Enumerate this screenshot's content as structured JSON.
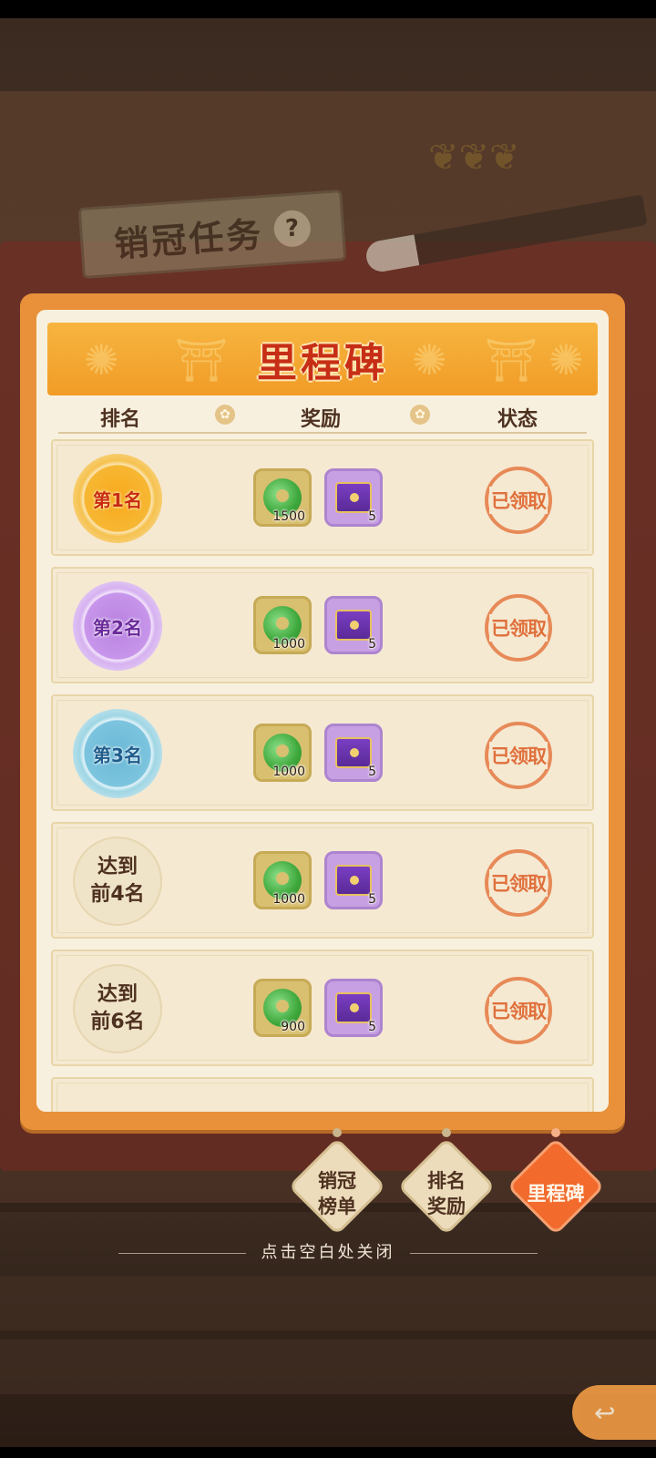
{
  "background": {
    "title_tag": "销冠任务",
    "help_icon": "?"
  },
  "panel": {
    "title": "里程碑",
    "headers": {
      "rank": "排名",
      "reward": "奖励",
      "status": "状态"
    },
    "rows": [
      {
        "rank": "第1名",
        "medal": "gold",
        "jade_count": "1500",
        "chest_count": "5",
        "status": "已领取"
      },
      {
        "rank": "第2名",
        "medal": "purple",
        "jade_count": "1000",
        "chest_count": "5",
        "status": "已领取"
      },
      {
        "rank": "第3名",
        "medal": "blue",
        "jade_count": "1000",
        "chest_count": "5",
        "status": "已领取"
      },
      {
        "rank_line1": "达到",
        "rank_line2": "前4名",
        "medal": "plain",
        "jade_count": "1000",
        "chest_count": "5",
        "status": "已领取"
      },
      {
        "rank_line1": "达到",
        "rank_line2": "前6名",
        "medal": "plain",
        "jade_count": "900",
        "chest_count": "5",
        "status": "已领取"
      }
    ]
  },
  "tabs": [
    {
      "line1": "销冠",
      "line2": "榜单",
      "active": false
    },
    {
      "line1": "排名",
      "line2": "奖励",
      "active": false
    },
    {
      "line1": "里程碑",
      "active": true
    }
  ],
  "close_hint": "点击空白处关闭",
  "icons": {
    "jade": "jade-coin-icon",
    "chest": "purple-chest-icon",
    "back": "back-arrow-icon"
  },
  "colors": {
    "panel_border": "#e8913a",
    "banner": "#f6b540",
    "title_text": "#c72e16",
    "stamp": "#e0703c",
    "active_tab": "#f26a2c"
  }
}
